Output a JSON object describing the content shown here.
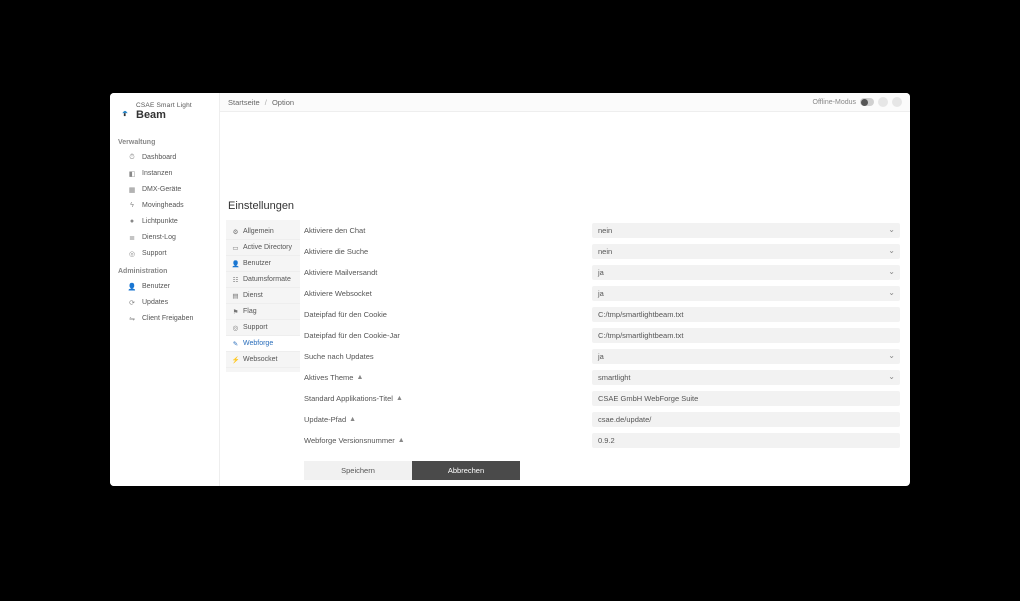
{
  "logo": {
    "line1": "CSAE Smart Light",
    "line2": "Beam"
  },
  "nav": {
    "section1": "Verwaltung",
    "section2": "Administration",
    "items1": [
      {
        "icon": "tachometer",
        "label": "Dashboard"
      },
      {
        "icon": "cube",
        "label": "Instanzen"
      },
      {
        "icon": "cubes",
        "label": "DMX-Geräte"
      },
      {
        "icon": "lightbulb",
        "label": "Movingheads"
      },
      {
        "icon": "dot",
        "label": "Lichtpunkte"
      },
      {
        "icon": "list",
        "label": "Dienst-Log"
      },
      {
        "icon": "life-ring",
        "label": "Support"
      }
    ],
    "items2": [
      {
        "icon": "user",
        "label": "Benutzer"
      },
      {
        "icon": "refresh",
        "label": "Updates"
      },
      {
        "icon": "share",
        "label": "Client Freigaben"
      }
    ]
  },
  "topbar": {
    "bc1": "Startseite",
    "bc2": "Option",
    "offline": "Offline-Modus"
  },
  "page_title": "Einstellungen",
  "tabs": [
    {
      "icon": "cogs",
      "label": "Allgemein"
    },
    {
      "icon": "id-card",
      "label": "Active Directory"
    },
    {
      "icon": "user",
      "label": "Benutzer"
    },
    {
      "icon": "calendar",
      "label": "Datumsformate"
    },
    {
      "icon": "server",
      "label": "Dienst"
    },
    {
      "icon": "flag",
      "label": "Flag"
    },
    {
      "icon": "life-ring",
      "label": "Support"
    },
    {
      "icon": "pencil",
      "label": "Webforge",
      "active": true
    },
    {
      "icon": "plug",
      "label": "Websocket"
    }
  ],
  "form": {
    "rows": [
      {
        "label": "Aktiviere den Chat",
        "type": "select",
        "value": "nein"
      },
      {
        "label": "Aktiviere die Suche",
        "type": "select",
        "value": "nein"
      },
      {
        "label": "Aktiviere Mailversandt",
        "type": "select",
        "value": "ja"
      },
      {
        "label": "Aktiviere Websocket",
        "type": "select",
        "value": "ja"
      },
      {
        "label": "Dateipfad für den Cookie",
        "type": "text",
        "value": "C:/tmp/smartlightbeam.txt"
      },
      {
        "label": "Dateipfad für den Cookie-Jar",
        "type": "text",
        "value": "C:/tmp/smartlightbeam.txt"
      },
      {
        "label": "Suche nach Updates",
        "type": "select",
        "value": "ja"
      },
      {
        "label": "Aktives Theme",
        "warn": true,
        "type": "select",
        "value": "smartlight"
      },
      {
        "label": "Standard Applikations-Titel",
        "warn": true,
        "type": "text",
        "value": "CSAE GmbH WebForge Suite"
      },
      {
        "label": "Update-Pfad",
        "warn": true,
        "type": "text",
        "value": "csae.de/update/"
      },
      {
        "label": "Webforge Versionsnummer",
        "warn": true,
        "type": "text",
        "value": "0.9.2"
      }
    ],
    "save": "Speichern",
    "cancel": "Abbrechen"
  }
}
